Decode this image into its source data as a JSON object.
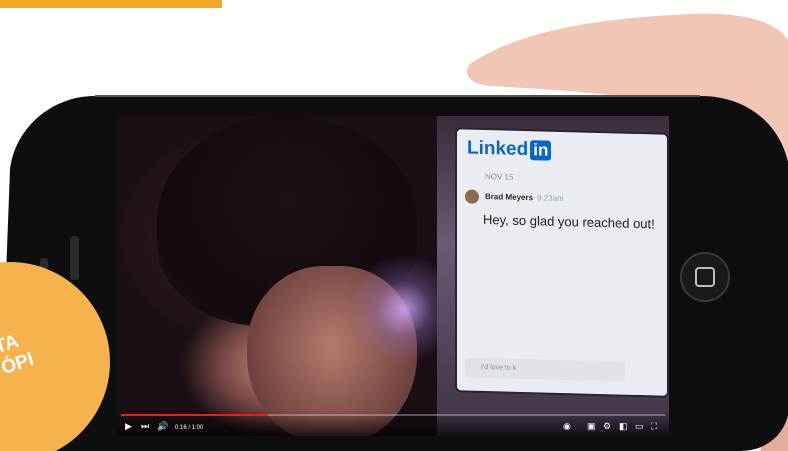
{
  "linkedin": {
    "logo_text": "Linked",
    "logo_box": "in",
    "date": "NOV 15",
    "sender_name": "Brad Meyers",
    "sender_time": "9:23am",
    "message": "Hey, so glad you reached out!",
    "input_placeholder": "I'd love to k"
  },
  "video": {
    "time": "0:16 / 1:00",
    "progress": 0.27
  },
  "badge": {
    "line1": "TA",
    "line2": "ÓPI"
  },
  "colors": {
    "badge": "#f5b24d",
    "top_strip": "#f5a623",
    "linkedin_blue": "#0a66c2",
    "progress_red": "#e62117"
  }
}
